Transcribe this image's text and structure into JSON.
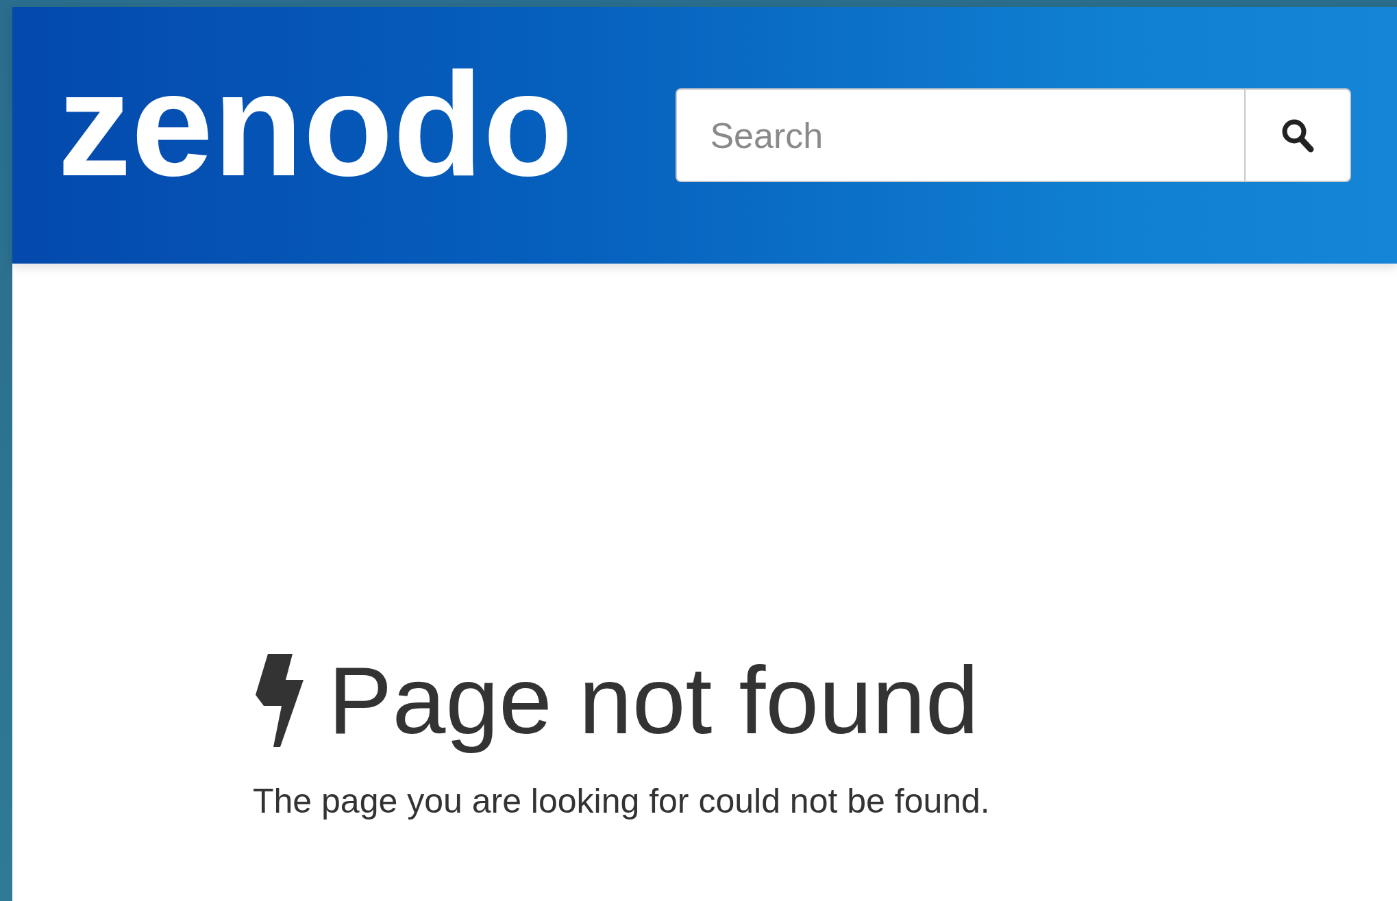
{
  "logo": {
    "text": "zenodo"
  },
  "search": {
    "placeholder": "Search"
  },
  "error": {
    "title": "Page not found",
    "message": "The page you are looking for could not be found."
  }
}
